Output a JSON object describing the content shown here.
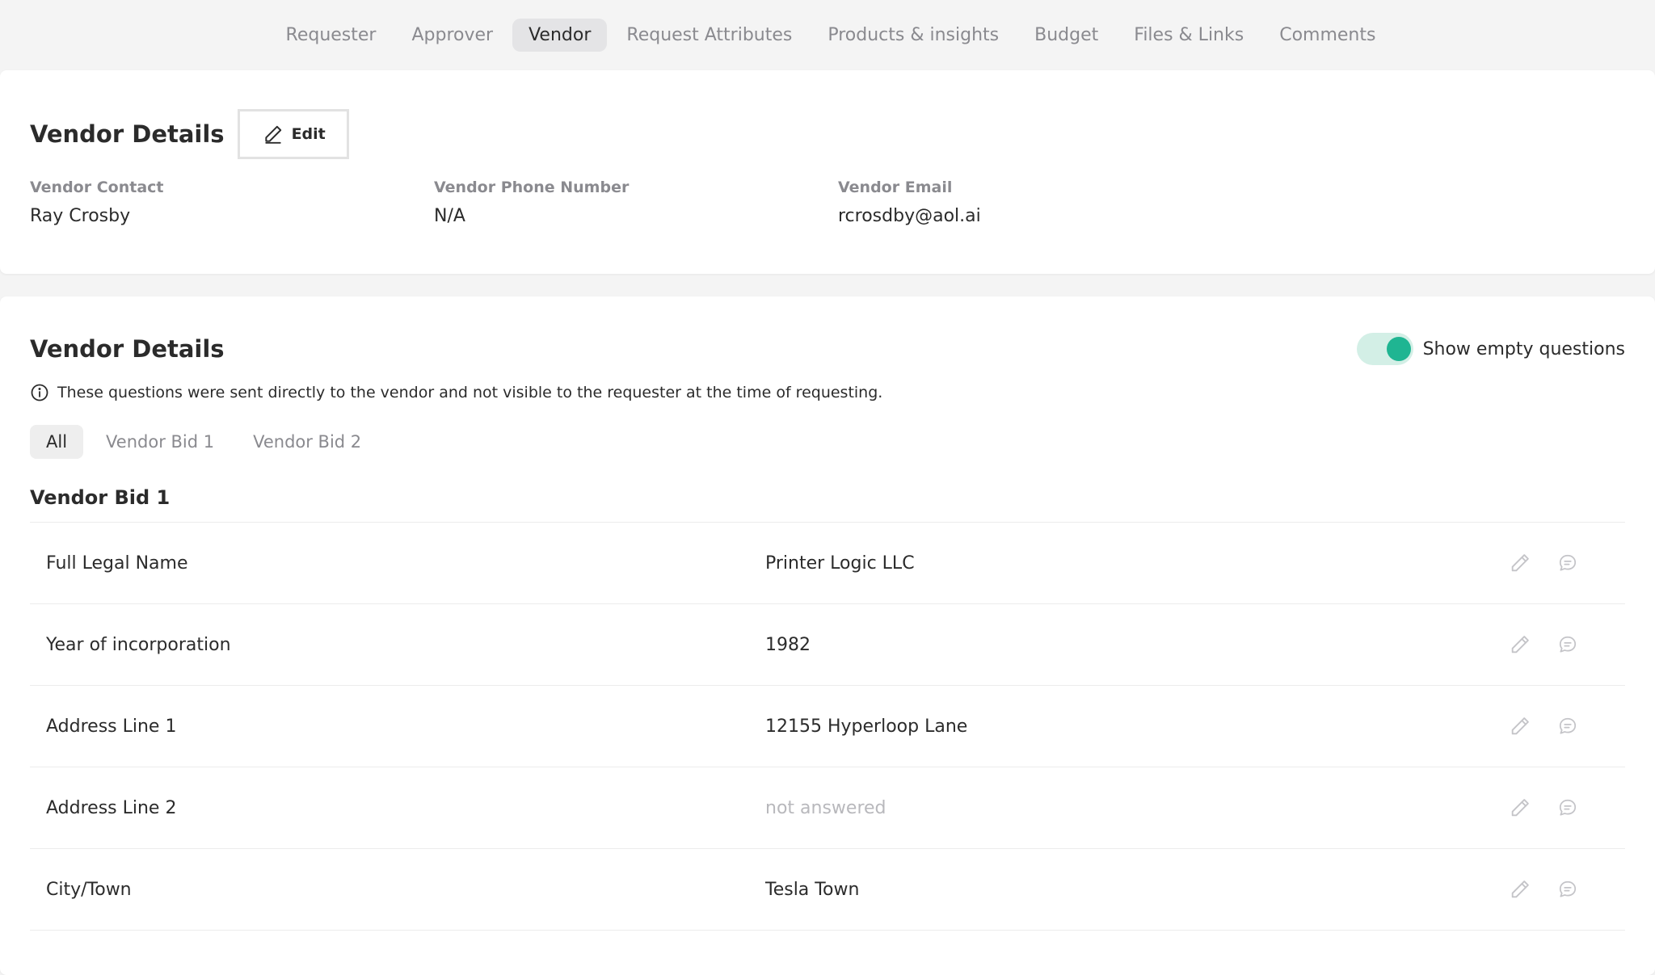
{
  "tabs": [
    "Requester",
    "Approver",
    "Vendor",
    "Request Attributes",
    "Products & insights",
    "Budget",
    "Files & Links",
    "Comments"
  ],
  "active_tab": "Vendor",
  "vendor_card": {
    "title": "Vendor Details",
    "edit_label": "Edit",
    "fields": [
      {
        "label": "Vendor Contact",
        "value": "Ray Crosby"
      },
      {
        "label": "Vendor Phone Number",
        "value": "N/A"
      },
      {
        "label": "Vendor Email",
        "value": "rcrosdby@aol.ai"
      }
    ]
  },
  "questions_card": {
    "title": "Vendor Details",
    "toggle_label": "Show empty questions",
    "toggle_on": true,
    "info_text": "These questions were sent directly to the vendor and not visible to the requester at the time of requesting.",
    "subtabs": [
      "All",
      "Vendor Bid 1",
      "Vendor Bid 2"
    ],
    "active_subtab": "All",
    "section_title": "Vendor Bid 1",
    "rows": [
      {
        "label": "Full Legal Name",
        "value": "Printer Logic LLC"
      },
      {
        "label": "Year of incorporation",
        "value": "1982"
      },
      {
        "label": "Address Line 1",
        "value": "12155 Hyperloop Lane"
      },
      {
        "label": "Address Line 2",
        "value": "not answered"
      },
      {
        "label": "City/Town",
        "value": "Tesla Town"
      }
    ]
  },
  "colors": {
    "accent": "#1fb592",
    "toggle_track": "#d3efe6",
    "muted": "#8a8a8f"
  },
  "icons": {
    "edit": "pencil-icon",
    "info": "info-icon",
    "comment": "comment-icon"
  }
}
